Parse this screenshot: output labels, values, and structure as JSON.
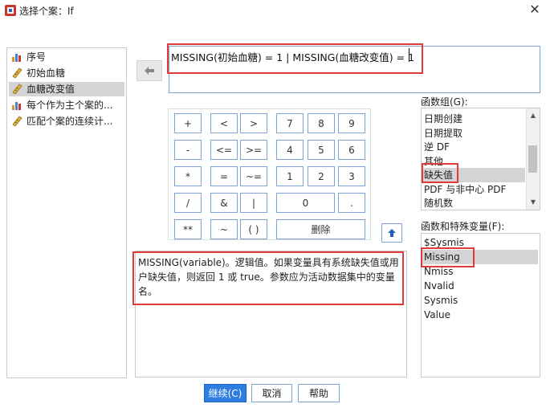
{
  "window": {
    "title": "选择个案：If",
    "close_glyph": "✕"
  },
  "variables": [
    {
      "label": "序号",
      "icon": "scale-bar-icon"
    },
    {
      "label": "初始血糖",
      "icon": "ruler-icon"
    },
    {
      "label": "血糖改变值",
      "icon": "ruler-icon",
      "selected": true
    },
    {
      "label": "每个作为主个案的...",
      "icon": "scale-bar-icon"
    },
    {
      "label": "匹配个案的连续计...",
      "icon": "ruler-icon"
    }
  ],
  "expression": {
    "value": "MISSING(初始血糖) = 1 | MISSING(血糖改变值) = 1"
  },
  "keypad": {
    "keys": [
      "+",
      "<",
      ">",
      "7",
      "8",
      "9",
      "-",
      "<=",
      ">=",
      "4",
      "5",
      "6",
      "*",
      "=",
      "~=",
      "1",
      "2",
      "3",
      "/",
      "&",
      "|",
      "0",
      ".",
      "**",
      "~",
      "( )",
      "删除"
    ]
  },
  "description": {
    "text": "MISSING(variable)。逻辑值。如果变量具有系统缺失值或用户缺失值，则返回 1 或 true。参数应为活动数据集中的变量名。"
  },
  "function_group": {
    "label": "函数组(G):",
    "items": [
      "日期创建",
      "日期提取",
      "逆 DF",
      "其他",
      "缺失值",
      "PDF 与非中心 PDF",
      "随机数"
    ],
    "selected_index": 4
  },
  "special_vars": {
    "label": "函数和特殊变量(F):",
    "items": [
      "$Sysmis",
      "Missing",
      "Nmiss",
      "Nvalid",
      "Sysmis",
      "Value"
    ],
    "selected_index": 1
  },
  "buttons": {
    "continue": "继续(C)",
    "cancel": "取消",
    "help": "帮助"
  },
  "colors": {
    "accent": "#2e7de1",
    "highlight": "#e03a3a",
    "selection": "#d4d4d4"
  }
}
